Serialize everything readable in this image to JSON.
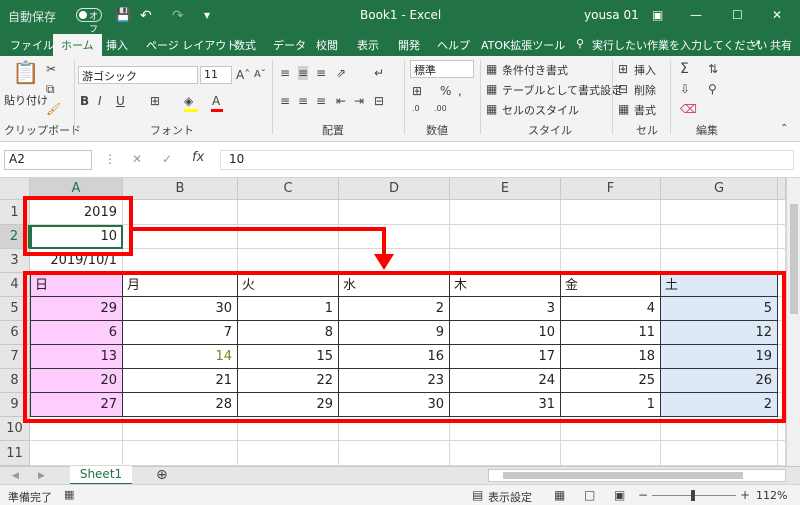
{
  "titlebar": {
    "autosave_label": "自動保存",
    "autosave_state": "オフ",
    "save_icon": "save-icon",
    "undo_icon": "undo-icon",
    "redo_icon": "redo-icon",
    "document_title": "Book1  -  Excel",
    "user": "yousa 01"
  },
  "tabs": [
    "ファイル",
    "ホーム",
    "挿入",
    "ページ レイアウト",
    "数式",
    "データ",
    "校閲",
    "表示",
    "開発",
    "ヘルプ",
    "ATOK拡張ツール"
  ],
  "tell_me": "実行したい作業を入力してください",
  "share": "共有",
  "ribbon": {
    "clipboard": {
      "paste": "貼り付け",
      "label": "クリップボード"
    },
    "font": {
      "name": "游ゴシック",
      "size": "11",
      "label": "フォント"
    },
    "alignment": {
      "label": "配置"
    },
    "number": {
      "format": "標準",
      "label": "数値"
    },
    "style": {
      "cond": "条件付き書式",
      "table": "テーブルとして書式設定",
      "cell": "セルのスタイル",
      "label": "スタイル"
    },
    "cells": {
      "insert": "挿入",
      "delete": "削除",
      "format": "書式",
      "label": "セル"
    },
    "edit": {
      "label": "編集"
    }
  },
  "formula_bar": {
    "name_box": "A2",
    "fx": "fx",
    "value": "10"
  },
  "columns": [
    "A",
    "B",
    "C",
    "D",
    "E",
    "F",
    "G"
  ],
  "rows": [
    "1",
    "2",
    "3",
    "4",
    "5",
    "6",
    "7",
    "8",
    "9",
    "10",
    "11"
  ],
  "cells": {
    "a1": "2019",
    "a2": "10",
    "a3": "2019/10/1",
    "weekdays": [
      "日",
      "月",
      "火",
      "水",
      "木",
      "金",
      "土"
    ],
    "weeks": [
      [
        "29",
        "30",
        "1",
        "2",
        "3",
        "4",
        "5"
      ],
      [
        "6",
        "7",
        "8",
        "9",
        "10",
        "11",
        "12"
      ],
      [
        "13",
        "14",
        "15",
        "16",
        "17",
        "18",
        "19"
      ],
      [
        "20",
        "21",
        "22",
        "23",
        "24",
        "25",
        "26"
      ],
      [
        "27",
        "28",
        "29",
        "30",
        "31",
        "1",
        "2"
      ]
    ]
  },
  "sheet_tab": "Sheet1",
  "status": {
    "ready": "準備完了",
    "display_settings": "表示設定",
    "zoom": "112%"
  },
  "colors": {
    "excel_green": "#217346",
    "highlight_red": "#ff0000",
    "sunday_fill": "#fecdfe",
    "saturday_fill": "#dde9f6"
  }
}
